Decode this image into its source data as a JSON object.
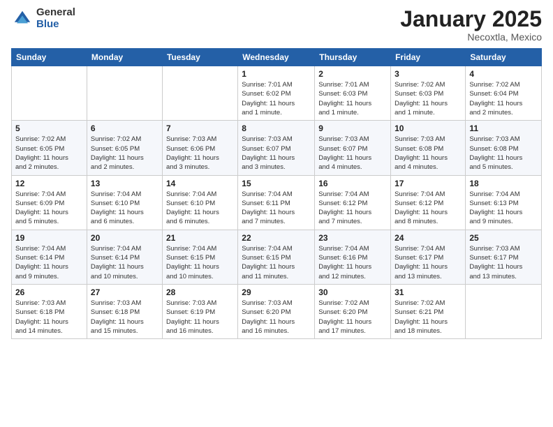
{
  "logo": {
    "general": "General",
    "blue": "Blue"
  },
  "header": {
    "month": "January 2025",
    "location": "Necoxtla, Mexico"
  },
  "days_of_week": [
    "Sunday",
    "Monday",
    "Tuesday",
    "Wednesday",
    "Thursday",
    "Friday",
    "Saturday"
  ],
  "weeks": [
    [
      {
        "day": "",
        "info": ""
      },
      {
        "day": "",
        "info": ""
      },
      {
        "day": "",
        "info": ""
      },
      {
        "day": "1",
        "info": "Sunrise: 7:01 AM\nSunset: 6:02 PM\nDaylight: 11 hours\nand 1 minute."
      },
      {
        "day": "2",
        "info": "Sunrise: 7:01 AM\nSunset: 6:03 PM\nDaylight: 11 hours\nand 1 minute."
      },
      {
        "day": "3",
        "info": "Sunrise: 7:02 AM\nSunset: 6:03 PM\nDaylight: 11 hours\nand 1 minute."
      },
      {
        "day": "4",
        "info": "Sunrise: 7:02 AM\nSunset: 6:04 PM\nDaylight: 11 hours\nand 2 minutes."
      }
    ],
    [
      {
        "day": "5",
        "info": "Sunrise: 7:02 AM\nSunset: 6:05 PM\nDaylight: 11 hours\nand 2 minutes."
      },
      {
        "day": "6",
        "info": "Sunrise: 7:02 AM\nSunset: 6:05 PM\nDaylight: 11 hours\nand 2 minutes."
      },
      {
        "day": "7",
        "info": "Sunrise: 7:03 AM\nSunset: 6:06 PM\nDaylight: 11 hours\nand 3 minutes."
      },
      {
        "day": "8",
        "info": "Sunrise: 7:03 AM\nSunset: 6:07 PM\nDaylight: 11 hours\nand 3 minutes."
      },
      {
        "day": "9",
        "info": "Sunrise: 7:03 AM\nSunset: 6:07 PM\nDaylight: 11 hours\nand 4 minutes."
      },
      {
        "day": "10",
        "info": "Sunrise: 7:03 AM\nSunset: 6:08 PM\nDaylight: 11 hours\nand 4 minutes."
      },
      {
        "day": "11",
        "info": "Sunrise: 7:03 AM\nSunset: 6:08 PM\nDaylight: 11 hours\nand 5 minutes."
      }
    ],
    [
      {
        "day": "12",
        "info": "Sunrise: 7:04 AM\nSunset: 6:09 PM\nDaylight: 11 hours\nand 5 minutes."
      },
      {
        "day": "13",
        "info": "Sunrise: 7:04 AM\nSunset: 6:10 PM\nDaylight: 11 hours\nand 6 minutes."
      },
      {
        "day": "14",
        "info": "Sunrise: 7:04 AM\nSunset: 6:10 PM\nDaylight: 11 hours\nand 6 minutes."
      },
      {
        "day": "15",
        "info": "Sunrise: 7:04 AM\nSunset: 6:11 PM\nDaylight: 11 hours\nand 7 minutes."
      },
      {
        "day": "16",
        "info": "Sunrise: 7:04 AM\nSunset: 6:12 PM\nDaylight: 11 hours\nand 7 minutes."
      },
      {
        "day": "17",
        "info": "Sunrise: 7:04 AM\nSunset: 6:12 PM\nDaylight: 11 hours\nand 8 minutes."
      },
      {
        "day": "18",
        "info": "Sunrise: 7:04 AM\nSunset: 6:13 PM\nDaylight: 11 hours\nand 9 minutes."
      }
    ],
    [
      {
        "day": "19",
        "info": "Sunrise: 7:04 AM\nSunset: 6:14 PM\nDaylight: 11 hours\nand 9 minutes."
      },
      {
        "day": "20",
        "info": "Sunrise: 7:04 AM\nSunset: 6:14 PM\nDaylight: 11 hours\nand 10 minutes."
      },
      {
        "day": "21",
        "info": "Sunrise: 7:04 AM\nSunset: 6:15 PM\nDaylight: 11 hours\nand 10 minutes."
      },
      {
        "day": "22",
        "info": "Sunrise: 7:04 AM\nSunset: 6:15 PM\nDaylight: 11 hours\nand 11 minutes."
      },
      {
        "day": "23",
        "info": "Sunrise: 7:04 AM\nSunset: 6:16 PM\nDaylight: 11 hours\nand 12 minutes."
      },
      {
        "day": "24",
        "info": "Sunrise: 7:04 AM\nSunset: 6:17 PM\nDaylight: 11 hours\nand 13 minutes."
      },
      {
        "day": "25",
        "info": "Sunrise: 7:03 AM\nSunset: 6:17 PM\nDaylight: 11 hours\nand 13 minutes."
      }
    ],
    [
      {
        "day": "26",
        "info": "Sunrise: 7:03 AM\nSunset: 6:18 PM\nDaylight: 11 hours\nand 14 minutes."
      },
      {
        "day": "27",
        "info": "Sunrise: 7:03 AM\nSunset: 6:18 PM\nDaylight: 11 hours\nand 15 minutes."
      },
      {
        "day": "28",
        "info": "Sunrise: 7:03 AM\nSunset: 6:19 PM\nDaylight: 11 hours\nand 16 minutes."
      },
      {
        "day": "29",
        "info": "Sunrise: 7:03 AM\nSunset: 6:20 PM\nDaylight: 11 hours\nand 16 minutes."
      },
      {
        "day": "30",
        "info": "Sunrise: 7:02 AM\nSunset: 6:20 PM\nDaylight: 11 hours\nand 17 minutes."
      },
      {
        "day": "31",
        "info": "Sunrise: 7:02 AM\nSunset: 6:21 PM\nDaylight: 11 hours\nand 18 minutes."
      },
      {
        "day": "",
        "info": ""
      }
    ]
  ]
}
